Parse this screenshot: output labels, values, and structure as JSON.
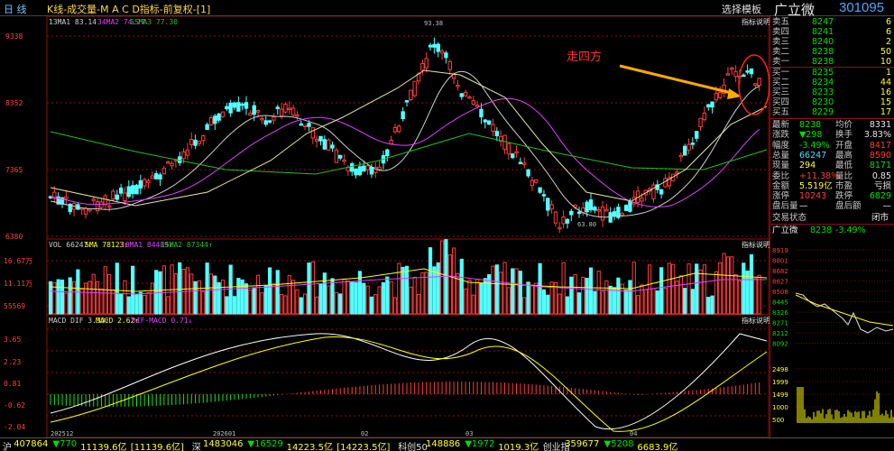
{
  "topbar": {
    "menu_label": "日 线",
    "chart_title": "K线-成交量-M A C D指标-前复权-[1]",
    "template_label": "选择模板",
    "stock_name": "广立微",
    "stock_code": "301095"
  },
  "colors": {
    "up": "#ff3c3c",
    "down": "#54ffff",
    "ma13": "#d0d0d0",
    "ma34": "#e040ff",
    "ma55": "#20c020",
    "grid": "#8a1010",
    "dif": "#ffffff",
    "dea": "#ffff00"
  },
  "kline": {
    "ma_legend": [
      "13MA1 83.14",
      "34MA2 74.77",
      "55MA3 77.30"
    ],
    "indicator_label": "指标说明",
    "y_ticks": [
      "9338",
      "8352",
      "7365",
      "6380"
    ],
    "high_mark": "93.38",
    "low_mark": "63.80",
    "annotation": "走四方"
  },
  "volume": {
    "legend": [
      "VOL 66247↓",
      "5MA 78123↑",
      "10MA1 84489↓",
      "15MA2 87344↑"
    ],
    "indicator_label": "指标说明",
    "y_ticks": [
      "16.67万",
      "11.11万",
      "55569"
    ]
  },
  "macd": {
    "legend": [
      "MACD DIF 3.33↑",
      "MACD 2.62↑",
      "DIF-MACD 0.71↓"
    ],
    "indicator_label": "指标说明",
    "y_ticks": [
      "3.65",
      "2.23",
      "0.81",
      "-0.62",
      "-2.04"
    ],
    "x_ticks": [
      "202512",
      "202601",
      "02",
      "03",
      "04"
    ]
  },
  "orderbook": {
    "sell": [
      {
        "label": "卖五",
        "price": "8247",
        "vol": "6"
      },
      {
        "label": "卖四",
        "price": "8241",
        "vol": "6"
      },
      {
        "label": "卖三",
        "price": "8240",
        "vol": "2"
      },
      {
        "label": "卖二",
        "price": "8238",
        "vol": "50"
      },
      {
        "label": "卖一",
        "price": "8238",
        "vol": "10"
      }
    ],
    "buy": [
      {
        "label": "买一",
        "price": "8235",
        "vol": "1"
      },
      {
        "label": "买二",
        "price": "8234",
        "vol": "44"
      },
      {
        "label": "买三",
        "price": "8233",
        "vol": "16"
      },
      {
        "label": "买四",
        "price": "8230",
        "vol": "15"
      },
      {
        "label": "买五",
        "price": "8229",
        "vol": "17"
      }
    ]
  },
  "quote": [
    {
      "l1": "最新",
      "v1": "8238",
      "l2": "均价",
      "v2": "8331",
      "c1": "green",
      "c2": "white"
    },
    {
      "l1": "涨跌",
      "v1": "▼298",
      "l2": "换手",
      "v2": "3.83%",
      "c1": "green",
      "c2": "white"
    },
    {
      "l1": "幅度",
      "v1": "-3.49%",
      "l2": "开盘",
      "v2": "8417",
      "c1": "green",
      "c2": "red"
    },
    {
      "l1": "总量",
      "v1": "66247",
      "l2": "最高",
      "v2": "8590",
      "c1": "cyan",
      "c2": "red"
    },
    {
      "l1": "现量",
      "v1": "294",
      "l2": "最低",
      "v2": "8171",
      "c1": "yellow",
      "c2": "green"
    },
    {
      "l1": "委比",
      "v1": "+11.38%",
      "l2": "量比",
      "v2": "0.85",
      "c1": "red",
      "c2": "white"
    },
    {
      "l1": "金额",
      "v1": "5.519亿",
      "l2": "市盈",
      "v2": "亏损",
      "c1": "yellow",
      "c2": "white"
    },
    {
      "l1": "涨停",
      "v1": "10243",
      "l2": "跌停",
      "v2": "6829",
      "c1": "red",
      "c2": "green"
    },
    {
      "l1": "盘后量",
      "v1": "—",
      "l2": "盘后额",
      "v2": "—",
      "c1": "white",
      "c2": "white"
    }
  ],
  "status": {
    "label": "交易状态",
    "value": "闭市"
  },
  "mini_chart": {
    "name": "广立微",
    "price": "8238",
    "change": "-3.49%",
    "price_ticks": [
      "8919",
      "8801",
      "8682",
      "8627",
      "8508",
      "8445",
      "8326",
      "8271",
      "8212",
      "8092"
    ],
    "vol_ticks": [
      "2498",
      "1999",
      "1499",
      "1000",
      "500"
    ]
  },
  "bottom": {
    "items": [
      {
        "text": "沪",
        "color": "white"
      },
      {
        "text": "407864",
        "color": "yellow"
      },
      {
        "text": "▼770",
        "color": "green"
      },
      {
        "text": "11139.6亿",
        "color": "yellow"
      },
      {
        "text": "[11139.6亿]",
        "color": "yellow"
      },
      {
        "text": "深",
        "color": "white"
      },
      {
        "text": "1483046",
        "color": "yellow"
      },
      {
        "text": "▼16529",
        "color": "green"
      },
      {
        "text": "14223.5亿",
        "color": "yellow"
      },
      {
        "text": "[14223.5亿]",
        "color": "yellow"
      },
      {
        "text": "科创50",
        "color": "white"
      },
      {
        "text": "148886",
        "color": "yellow"
      },
      {
        "text": "▼1972",
        "color": "green"
      },
      {
        "text": "1019.3亿",
        "color": "yellow"
      },
      {
        "text": "创业指",
        "color": "white"
      },
      {
        "text": "359677",
        "color": "yellow"
      },
      {
        "text": "▼5208",
        "color": "green"
      },
      {
        "text": "6683.9亿",
        "color": "yellow"
      }
    ]
  }
}
